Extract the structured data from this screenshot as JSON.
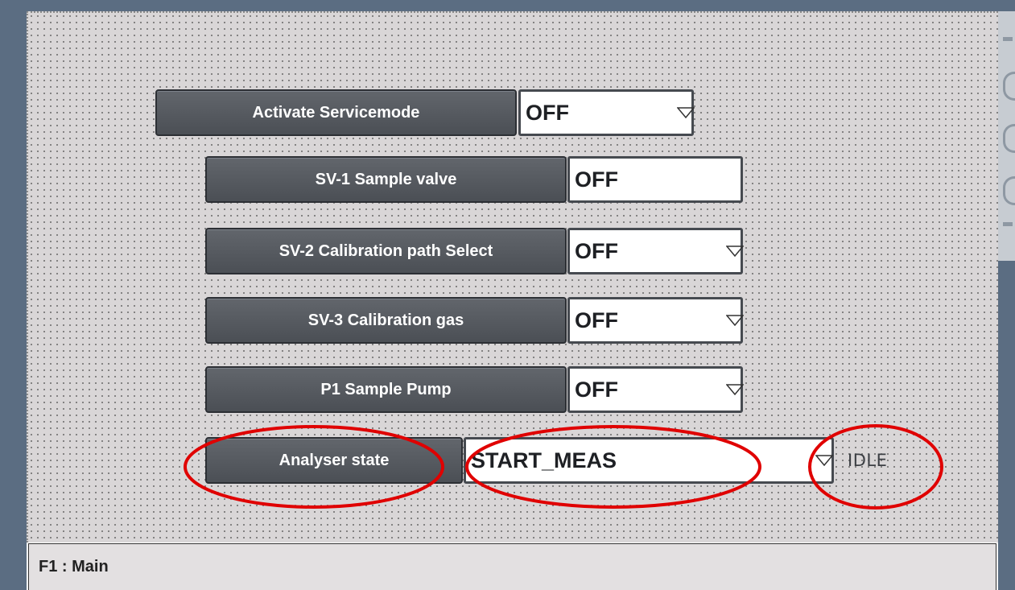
{
  "rows": [
    {
      "id": "servicemode",
      "button_label": "Activate Servicemode",
      "value": "OFF",
      "has_dropdown": true
    },
    {
      "id": "sv1",
      "button_label": "SV-1 Sample valve",
      "value": "OFF",
      "has_dropdown": false
    },
    {
      "id": "sv2",
      "button_label": "SV-2  Calibration path Select",
      "value": "OFF",
      "has_dropdown": true
    },
    {
      "id": "sv3",
      "button_label": "SV-3 Calibration gas",
      "value": "OFF",
      "has_dropdown": true
    },
    {
      "id": "p1",
      "button_label": "P1 Sample Pump",
      "value": "OFF",
      "has_dropdown": true
    },
    {
      "id": "analyser",
      "button_label": "Analyser state",
      "value": "START_MEAS",
      "has_dropdown": true
    }
  ],
  "analyser_status_text": "IDLE",
  "status_bar": {
    "text": "F1 : Main"
  },
  "colors": {
    "button": "#55595f",
    "frame": "#5b6d82",
    "annotation": "#e00000",
    "screen_bg": "#d9d6d7"
  }
}
